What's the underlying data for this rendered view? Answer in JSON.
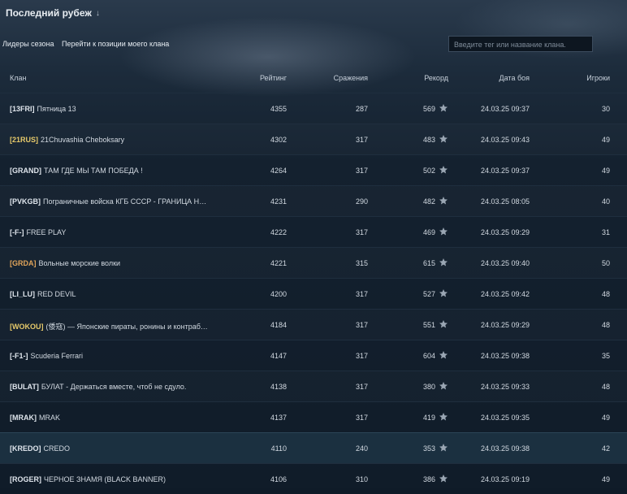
{
  "header": {
    "title": "Последний рубеж",
    "dropdown_icon": "arrow-down-icon"
  },
  "toolbar": {
    "tab_leaders": "Лидеры сезона",
    "tab_goto": "Перейти к позиции моего клана",
    "search_placeholder": "Введите тег или название клана."
  },
  "table": {
    "columns": [
      "Клан",
      "Рейтинг",
      "Сражения",
      "Рекорд",
      "Дата боя",
      "Игроки"
    ],
    "rows": [
      {
        "tag": "[13FRI]",
        "tag_color": "#dfe5ec",
        "name": "Пятница 13",
        "rating": "4355",
        "battles": "287",
        "record": "569",
        "date": "24.03.25 09:37",
        "players": "30"
      },
      {
        "tag": "[21RUS]",
        "tag_color": "#e6c96a",
        "name": "21Chuvashia Cheboksary",
        "rating": "4302",
        "battles": "317",
        "record": "483",
        "date": "24.03.25 09:43",
        "players": "49"
      },
      {
        "tag": "[GRAND]",
        "tag_color": "#dfe5ec",
        "name": "ТАМ ГДЕ МЫ ТАМ ПОБЕДА !",
        "rating": "4264",
        "battles": "317",
        "record": "502",
        "date": "24.03.25 09:37",
        "players": "49"
      },
      {
        "tag": "[PVKGB]",
        "tag_color": "#dfe5ec",
        "name": "Пограничные войска КГБ СССР - ГРАНИЦА НА ЗА...",
        "rating": "4231",
        "battles": "290",
        "record": "482",
        "date": "24.03.25 08:05",
        "players": "40"
      },
      {
        "tag": "[-F-]",
        "tag_color": "#dfe5ec",
        "name": "FREE PLAY",
        "rating": "4222",
        "battles": "317",
        "record": "469",
        "date": "24.03.25 09:29",
        "players": "31"
      },
      {
        "tag": "[GRDA]",
        "tag_color": "#e0a45a",
        "name": "Вольные морские волки",
        "rating": "4221",
        "battles": "315",
        "record": "615",
        "date": "24.03.25 09:40",
        "players": "50"
      },
      {
        "tag": "[LI_LU]",
        "tag_color": "#dfe5ec",
        "name": "RED DEVIL",
        "rating": "4200",
        "battles": "317",
        "record": "527",
        "date": "24.03.25 09:42",
        "players": "48"
      },
      {
        "tag": "[WOKOU]",
        "tag_color": "#e6c96a",
        "name": "(倭寇) — Японские пираты, ронины и контрабанд...",
        "rating": "4184",
        "battles": "317",
        "record": "551",
        "date": "24.03.25 09:29",
        "players": "48"
      },
      {
        "tag": "[-F1-]",
        "tag_color": "#dfe5ec",
        "name": "Scuderia Ferrari",
        "rating": "4147",
        "battles": "317",
        "record": "604",
        "date": "24.03.25 09:38",
        "players": "35"
      },
      {
        "tag": "[BULAT]",
        "tag_color": "#dfe5ec",
        "name": "БУЛАТ - Держаться вместе, чтоб не сдуло.",
        "rating": "4138",
        "battles": "317",
        "record": "380",
        "date": "24.03.25 09:33",
        "players": "48"
      },
      {
        "tag": "[MRAK]",
        "tag_color": "#dfe5ec",
        "name": "MRAK",
        "rating": "4137",
        "battles": "317",
        "record": "419",
        "date": "24.03.25 09:35",
        "players": "49"
      },
      {
        "tag": "[KREDO]",
        "tag_color": "#dfe5ec",
        "name": "CREDO",
        "rating": "4110",
        "battles": "240",
        "record": "353",
        "date": "24.03.25 09:38",
        "players": "42",
        "selected": true
      },
      {
        "tag": "[ROGER]",
        "tag_color": "#dfe5ec",
        "name": "ЧЕРНОЕ ЗНАМЯ (BLACK BANNER)",
        "rating": "4106",
        "battles": "310",
        "record": "386",
        "date": "24.03.25 09:19",
        "players": "49"
      }
    ],
    "record_icon": "star-icon"
  }
}
